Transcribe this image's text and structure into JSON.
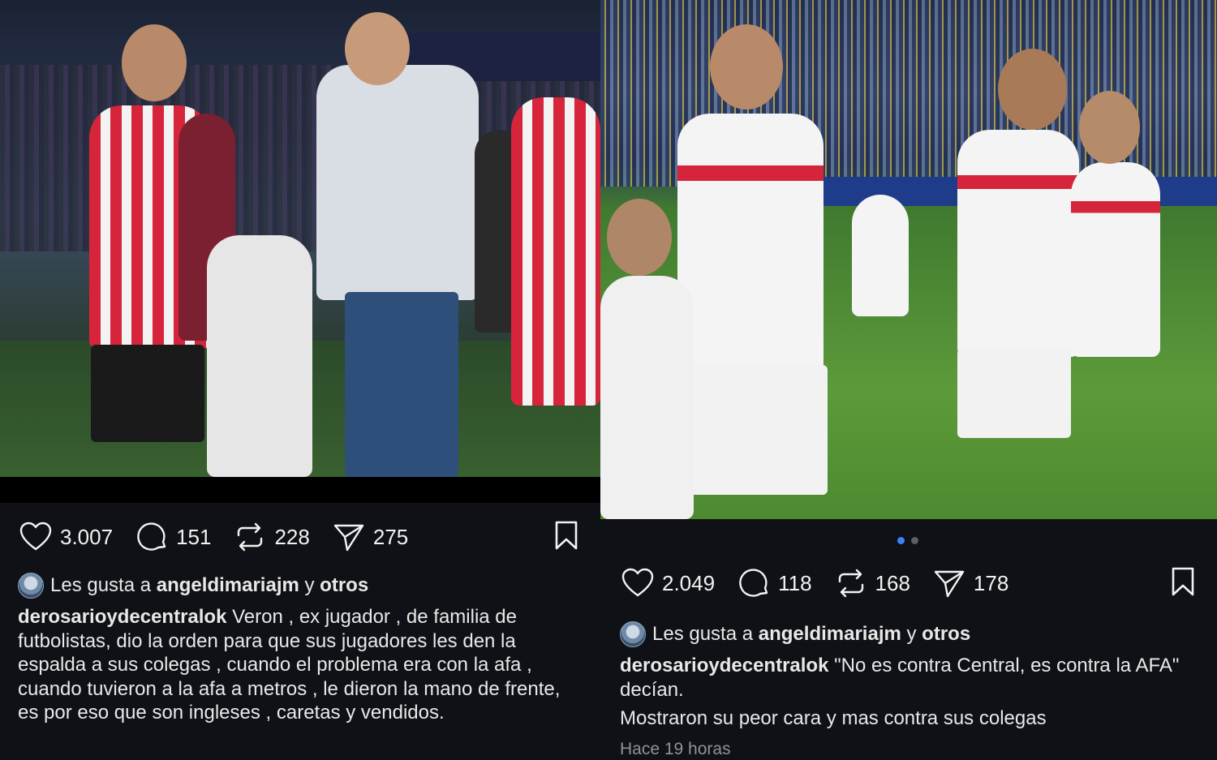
{
  "left_post": {
    "metrics": {
      "likes": "3.007",
      "comments": "151",
      "reposts": "228",
      "shares": "275"
    },
    "liked_by": {
      "prefix": "Les gusta a ",
      "user": "angeldimariajm",
      "connector": " y ",
      "others": "otros"
    },
    "caption": {
      "username": "derosarioydecentralok",
      "text": " Veron , ex jugador , de familia de futbolistas,  dio la orden para que sus jugadores les den la espalda a sus colegas , cuando el problema era con la afa , cuando tuvieron a la afa a metros , le dieron la mano de frente,  es por eso que son ingleses , caretas y vendidos."
    }
  },
  "right_post": {
    "metrics": {
      "likes": "2.049",
      "comments": "118",
      "reposts": "168",
      "shares": "178"
    },
    "carousel": {
      "count": 2,
      "active_index": 0
    },
    "liked_by": {
      "prefix": "Les gusta a ",
      "user": "angeldimariajm",
      "connector": " y ",
      "others": "otros"
    },
    "caption": {
      "username": "derosarioydecentralok",
      "text": " \"No es contra Central, es contra la AFA\" decían.",
      "text_line2": "Mostraron su peor cara y mas contra sus colegas"
    },
    "timestamp": "Hace 19 horas"
  },
  "icons": {
    "like": "heart-icon",
    "comment": "comment-bubble-icon",
    "repost": "repost-icon",
    "share": "send-icon",
    "save": "bookmark-icon"
  },
  "colors": {
    "background": "#0f1116",
    "text": "#f2f2f2",
    "muted": "#8e9299",
    "dot_active": "#3b82f6"
  }
}
